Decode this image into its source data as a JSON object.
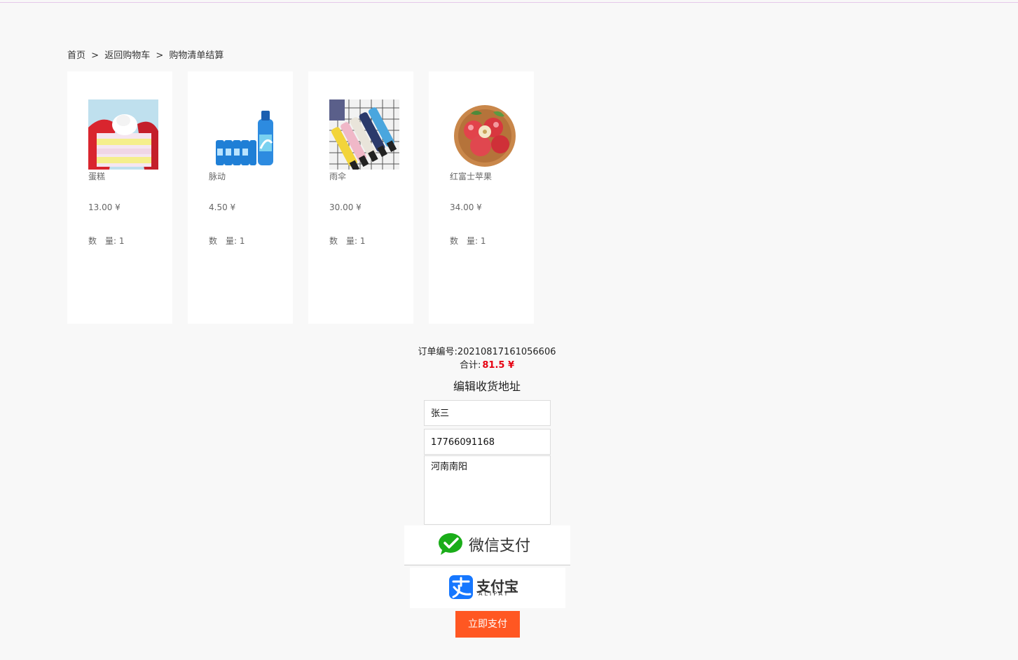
{
  "breadcrumb": {
    "home": "首页",
    "cart": "返回购物车",
    "current": "购物清单结算",
    "separator": ">"
  },
  "products": [
    {
      "name": "蛋糕",
      "price": "13.00 ¥",
      "qty_label": "数　量:",
      "qty": "1",
      "image_icon": "cake-image"
    },
    {
      "name": "脉动",
      "price": "4.50 ¥",
      "qty_label": "数　量:",
      "qty": "1",
      "image_icon": "drink-image"
    },
    {
      "name": "雨伞",
      "price": "30.00 ¥",
      "qty_label": "数　量:",
      "qty": "1",
      "image_icon": "umbrella-image"
    },
    {
      "name": "红富士苹果",
      "price": "34.00 ¥",
      "qty_label": "数　量:",
      "qty": "1",
      "image_icon": "apple-image"
    }
  ],
  "order": {
    "number_label": "订单编号:",
    "number": "20210817161056606",
    "total_label": "合计:",
    "total": "81.5 ¥"
  },
  "address": {
    "title": "编辑收货地址",
    "name": "张三",
    "phone": "17766091168",
    "address": "河南南阳"
  },
  "payment": {
    "wechat_label": "微信支付",
    "alipay_label": "支付宝",
    "alipay_sub": "ALIPAY",
    "pay_button": "立即支付"
  },
  "colors": {
    "background": "#f8f8f8",
    "accent": "#ff5722",
    "total": "#e60012",
    "wechat": "#1aad19",
    "alipay": "#1677ff"
  }
}
